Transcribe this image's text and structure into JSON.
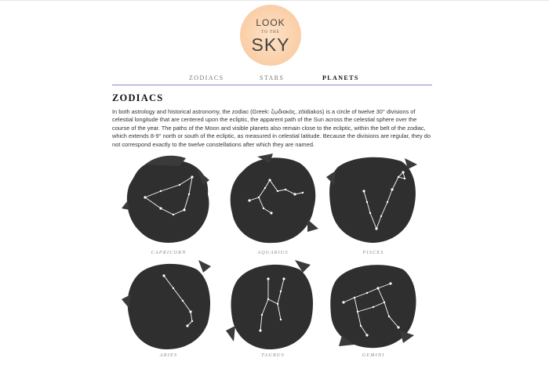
{
  "logo": {
    "line1": "LOOK",
    "line2": "TO THE",
    "line3": "SKY",
    "color": "#fbd2ad"
  },
  "nav": {
    "items": [
      "ZODIACS",
      "STARS",
      "PLANETS"
    ],
    "active": "PLANETS",
    "rule_color": "#8a8ac8"
  },
  "main": {
    "heading": "ZODIACS",
    "intro": "In both astrology and historical astronomy, the zodiac (Greek: ζῳδιακός, zōidiakos) is a circle of twelve 30° divisions of celestial longitude that are centered upon the ecliptic, the apparent path of the Sun across the celestial sphere over the course of the year. The paths of the Moon and visible planets also remain close to the ecliptic, within the belt of the zodiac, which extends 8-9° north or south of the ecliptic, as measured in celestial latitude. Because the divisions are regular, they do not correspond exactly to the twelve constellations after which they are named."
  },
  "zodiacs": [
    {
      "name": "CAPRICORN",
      "icon": "capricorn-constellation-icon"
    },
    {
      "name": "AQUARIUS",
      "icon": "aquarius-constellation-icon"
    },
    {
      "name": "PISCES",
      "icon": "pisces-constellation-icon"
    },
    {
      "name": "ARIES",
      "icon": "aries-constellation-icon"
    },
    {
      "name": "TAURUS",
      "icon": "taurus-constellation-icon"
    },
    {
      "name": "GEMINI",
      "icon": "gemini-constellation-icon"
    }
  ]
}
